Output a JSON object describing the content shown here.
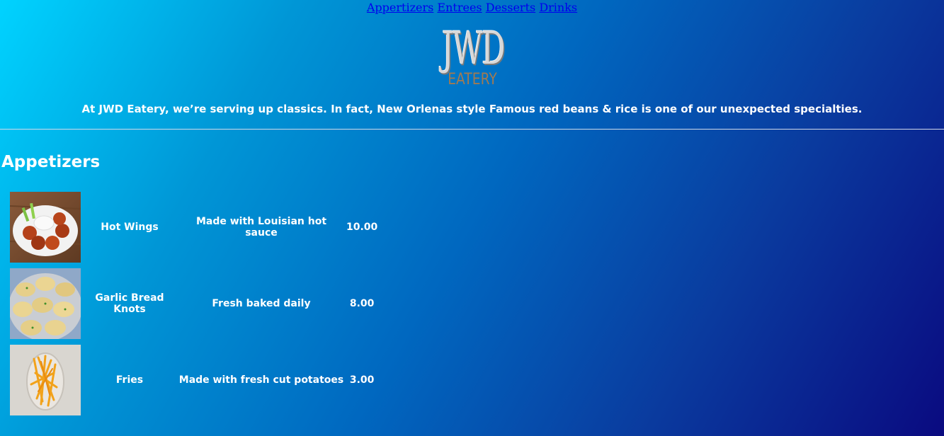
{
  "nav": {
    "links": [
      "Appertizers",
      "Entrees",
      "Desserts",
      "Drinks"
    ]
  },
  "logo": {
    "title": "JWD",
    "subtitle": "EATERY",
    "colors": {
      "title": "#d8d8d8",
      "subtitle": "#a07a52"
    }
  },
  "tagline": "At JWD Eatery, we’re serving up classics. In fact, New Orlenas style Famous red beans & rice is one of our unexpected specialties.",
  "section": {
    "title": "Appetizers"
  },
  "items": [
    {
      "image": "hot-wings-photo",
      "name": "Hot Wings",
      "description": "Made with Louisian hot sauce",
      "price": "10.00"
    },
    {
      "image": "garlic-knots-photo",
      "name": "Garlic Bread Knots",
      "description": "Fresh baked daily",
      "price": "8.00"
    },
    {
      "image": "fries-photo",
      "name": "Fries",
      "description": "Made with fresh cut potatoes",
      "price": "3.00"
    }
  ],
  "colors": {
    "gradient_start": "#00d3ff",
    "gradient_end": "#0a0a80",
    "link": "#0000ee",
    "text": "#ffffff"
  }
}
